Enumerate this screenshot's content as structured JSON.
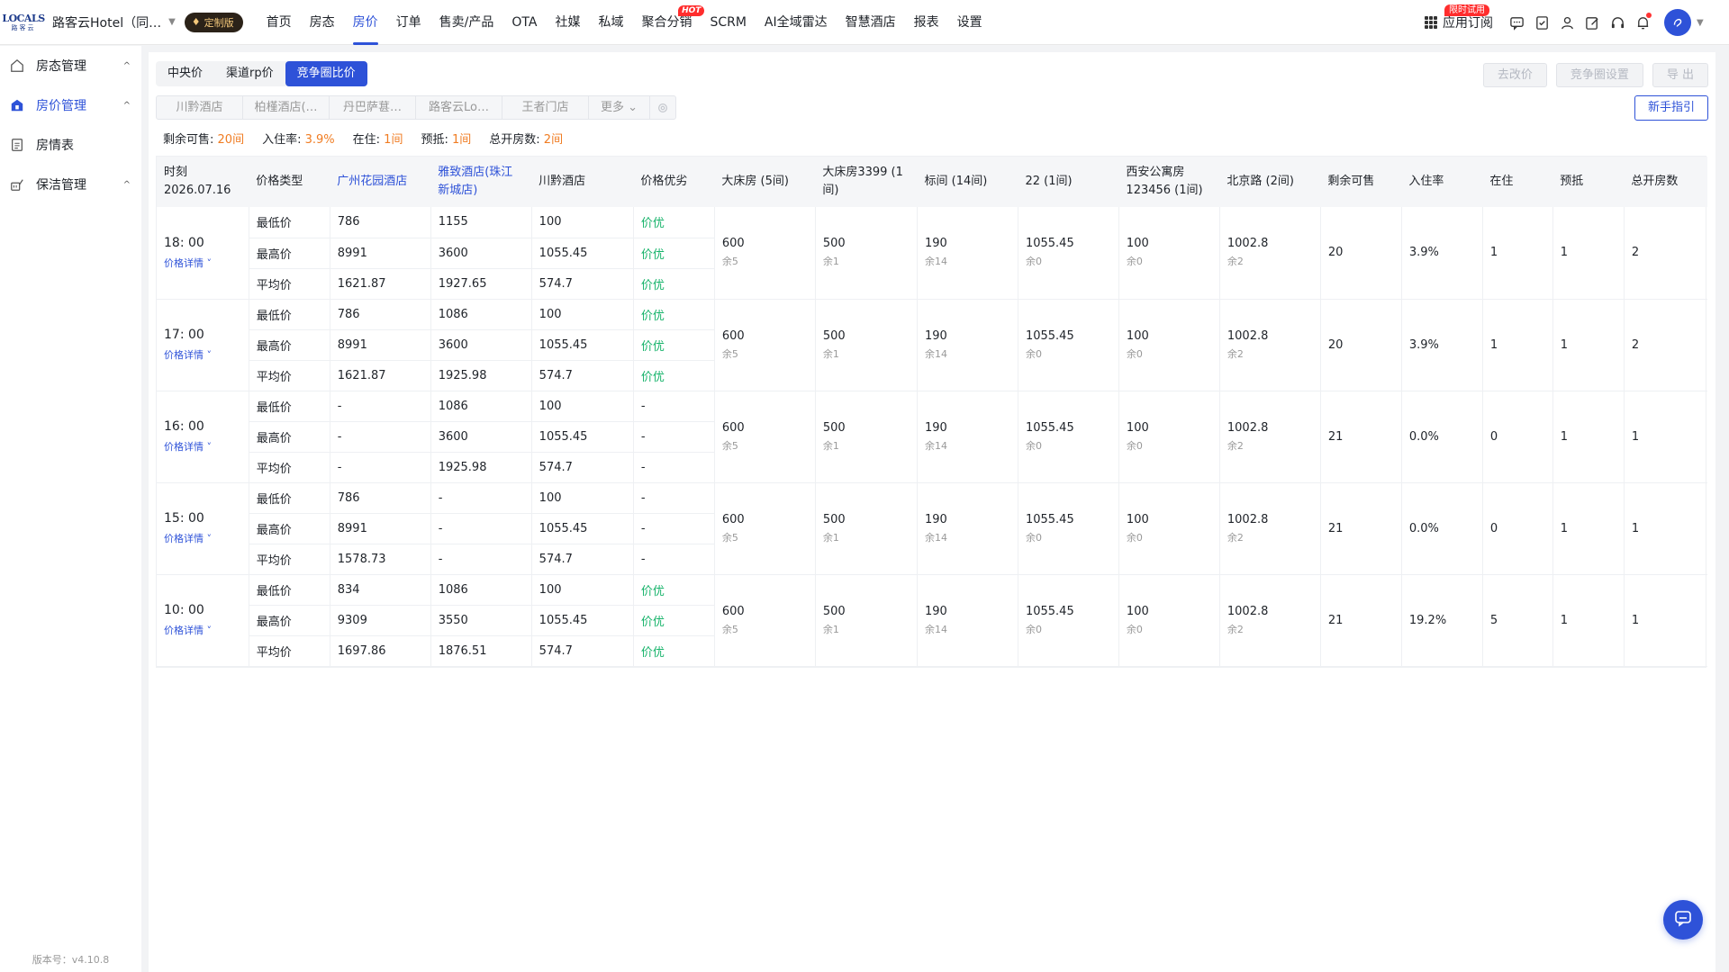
{
  "topbar": {
    "logo_en": "LOCALS",
    "logo_cn": "路客云",
    "hotel_name": "路客云Hotel（同…",
    "custom_badge": "定制版",
    "nav": [
      {
        "label": "首页"
      },
      {
        "label": "房态"
      },
      {
        "label": "房价"
      },
      {
        "label": "订单"
      },
      {
        "label": "售卖/产品"
      },
      {
        "label": "OTA"
      },
      {
        "label": "社媒"
      },
      {
        "label": "私域"
      },
      {
        "label": "聚合分销"
      },
      {
        "label": "SCRM"
      },
      {
        "label": "AI全域雷达"
      },
      {
        "label": "智慧酒店"
      },
      {
        "label": "报表"
      },
      {
        "label": "设置"
      }
    ],
    "active_nav": "房价",
    "hot_tag": "HOT",
    "app_subscribe": "应用订阅",
    "trial_tag": "限时试用"
  },
  "sidebar": {
    "items": [
      {
        "label": "房态管理",
        "icon": "home-icon"
      },
      {
        "label": "房价管理",
        "icon": "price-tag-icon"
      },
      {
        "label": "房情表",
        "icon": "clipboard-icon"
      },
      {
        "label": "保洁管理",
        "icon": "cleaning-icon"
      }
    ],
    "version": "版本号：v4.10.8"
  },
  "main": {
    "tabs": [
      {
        "label": "中央价"
      },
      {
        "label": "渠道rp价"
      },
      {
        "label": "竞争圈比价"
      }
    ],
    "active_tab": "竞争圈比价",
    "btn_change_price": "去改价",
    "btn_circle_settings": "竞争圈设置",
    "btn_export": "导 出",
    "btn_guide": "新手指引",
    "hotel_filters": [
      "川黔酒店",
      "柏槿酒店(…",
      "丹巴萨葚…",
      "路客云Lo…",
      "王者门店"
    ],
    "filter_more": "更多",
    "summary": {
      "remaining_label": "剩余可售:",
      "remaining_value": "20间",
      "occupancy_label": "入住率:",
      "occupancy_value": "3.9%",
      "inhouse_label": "在住:",
      "inhouse_value": "1间",
      "prepay_label": "预抵:",
      "prepay_value": "1间",
      "total_label": "总开房数:",
      "total_value": "2间"
    }
  },
  "table": {
    "headers": {
      "time": "时刻",
      "date": "2026.07.16",
      "price_type": "价格类型",
      "hotel1": "广州花园酒店",
      "hotel2": "雅致酒店(珠江新城店)",
      "hotel3": "川黔酒店",
      "advantage": "价格优劣",
      "room1": "大床房 (5间)",
      "room2": "大床房3399 (1间)",
      "room3": "标间 (14间)",
      "room4": "22 (1间)",
      "room5": "西安公寓房123456 (1间)",
      "room6": "北京路 (2间)",
      "remaining": "剩余可售",
      "occupancy": "入住率",
      "inhouse": "在住",
      "prepay": "预抵",
      "total": "总开房数"
    },
    "detail_label": "价格详情",
    "groups": [
      {
        "time": "18: 00",
        "rows": [
          {
            "type": "最低价",
            "h1": "786",
            "h2": "1155",
            "h3": "100",
            "adv": "价优"
          },
          {
            "type": "最高价",
            "h1": "8991",
            "h2": "3600",
            "h3": "1055.45",
            "adv": "价优"
          },
          {
            "type": "平均价",
            "h1": "1621.87",
            "h2": "1927.65",
            "h3": "574.7",
            "adv": "价优"
          }
        ],
        "rooms": [
          {
            "v": "600",
            "r": "余5"
          },
          {
            "v": "500",
            "r": "余1"
          },
          {
            "v": "190",
            "r": "余14"
          },
          {
            "v": "1055.45",
            "r": "余0"
          },
          {
            "v": "100",
            "r": "余0"
          },
          {
            "v": "1002.8",
            "r": "余2"
          }
        ],
        "remaining": "20",
        "occupancy": "3.9%",
        "inhouse": "1",
        "prepay": "1",
        "total": "2"
      },
      {
        "time": "17: 00",
        "rows": [
          {
            "type": "最低价",
            "h1": "786",
            "h2": "1086",
            "h3": "100",
            "adv": "价优"
          },
          {
            "type": "最高价",
            "h1": "8991",
            "h2": "3600",
            "h3": "1055.45",
            "adv": "价优"
          },
          {
            "type": "平均价",
            "h1": "1621.87",
            "h2": "1925.98",
            "h3": "574.7",
            "adv": "价优"
          }
        ],
        "rooms": [
          {
            "v": "600",
            "r": "余5"
          },
          {
            "v": "500",
            "r": "余1"
          },
          {
            "v": "190",
            "r": "余14"
          },
          {
            "v": "1055.45",
            "r": "余0"
          },
          {
            "v": "100",
            "r": "余0"
          },
          {
            "v": "1002.8",
            "r": "余2"
          }
        ],
        "remaining": "20",
        "occupancy": "3.9%",
        "inhouse": "1",
        "prepay": "1",
        "total": "2"
      },
      {
        "time": "16: 00",
        "rows": [
          {
            "type": "最低价",
            "h1": "-",
            "h2": "1086",
            "h3": "100",
            "adv": "-"
          },
          {
            "type": "最高价",
            "h1": "-",
            "h2": "3600",
            "h3": "1055.45",
            "adv": "-"
          },
          {
            "type": "平均价",
            "h1": "-",
            "h2": "1925.98",
            "h3": "574.7",
            "adv": "-"
          }
        ],
        "rooms": [
          {
            "v": "600",
            "r": "余5"
          },
          {
            "v": "500",
            "r": "余1"
          },
          {
            "v": "190",
            "r": "余14"
          },
          {
            "v": "1055.45",
            "r": "余0"
          },
          {
            "v": "100",
            "r": "余0"
          },
          {
            "v": "1002.8",
            "r": "余2"
          }
        ],
        "remaining": "21",
        "occupancy": "0.0%",
        "inhouse": "0",
        "prepay": "1",
        "total": "1"
      },
      {
        "time": "15: 00",
        "rows": [
          {
            "type": "最低价",
            "h1": "786",
            "h2": "-",
            "h3": "100",
            "adv": "-"
          },
          {
            "type": "最高价",
            "h1": "8991",
            "h2": "-",
            "h3": "1055.45",
            "adv": "-"
          },
          {
            "type": "平均价",
            "h1": "1578.73",
            "h2": "-",
            "h3": "574.7",
            "adv": "-"
          }
        ],
        "rooms": [
          {
            "v": "600",
            "r": "余5"
          },
          {
            "v": "500",
            "r": "余1"
          },
          {
            "v": "190",
            "r": "余14"
          },
          {
            "v": "1055.45",
            "r": "余0"
          },
          {
            "v": "100",
            "r": "余0"
          },
          {
            "v": "1002.8",
            "r": "余2"
          }
        ],
        "remaining": "21",
        "occupancy": "0.0%",
        "inhouse": "0",
        "prepay": "1",
        "total": "1"
      },
      {
        "time": "10: 00",
        "rows": [
          {
            "type": "最低价",
            "h1": "834",
            "h2": "1086",
            "h3": "100",
            "adv": "价优"
          },
          {
            "type": "最高价",
            "h1": "9309",
            "h2": "3550",
            "h3": "1055.45",
            "adv": "价优"
          },
          {
            "type": "平均价",
            "h1": "1697.86",
            "h2": "1876.51",
            "h3": "574.7",
            "adv": "价优"
          }
        ],
        "rooms": [
          {
            "v": "600",
            "r": "余5"
          },
          {
            "v": "500",
            "r": "余1"
          },
          {
            "v": "190",
            "r": "余14"
          },
          {
            "v": "1055.45",
            "r": "余0"
          },
          {
            "v": "100",
            "r": "余0"
          },
          {
            "v": "1002.8",
            "r": "余2"
          }
        ],
        "remaining": "21",
        "occupancy": "19.2%",
        "inhouse": "5",
        "prepay": "1",
        "total": "1"
      }
    ]
  },
  "colors": {
    "primary": "#2e52d8",
    "accent_orange": "#f07c22",
    "good_green": "#19b46c",
    "hot_red": "#ff2d2d"
  }
}
